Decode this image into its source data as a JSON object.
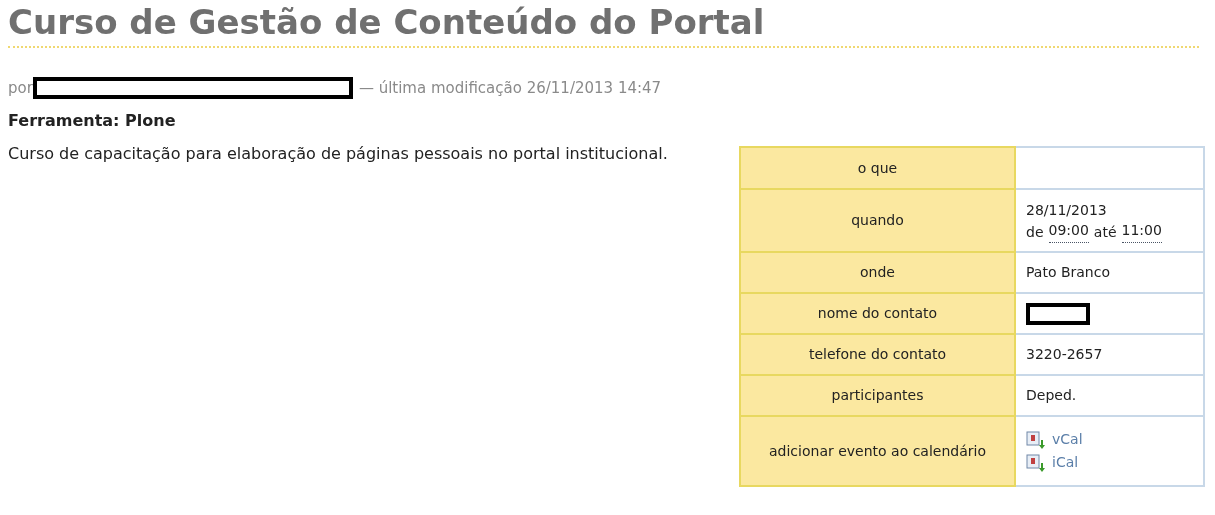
{
  "title": "Curso de Gestão de Conteúdo do Portal",
  "byline": {
    "prefix": "por",
    "suffix": "— última modificação 26/11/2013 14:47"
  },
  "subtitle": "Ferramenta: Plone",
  "description": "Curso de capacitação para elaboração de páginas pessoais no portal institucional.",
  "event_table": [
    {
      "label": "o que",
      "kind": "empty"
    },
    {
      "label": "quando",
      "kind": "when",
      "date": "28/11/2013",
      "from_word": "de",
      "start": "09:00",
      "to_word": "até",
      "end": "11:00"
    },
    {
      "label": "onde",
      "kind": "text",
      "value": "Pato Branco"
    },
    {
      "label": "nome do contato",
      "kind": "redacted"
    },
    {
      "label": "telefone do contato",
      "kind": "text",
      "value": "3220-2657"
    },
    {
      "label": "participantes",
      "kind": "text",
      "value": "Deped."
    },
    {
      "label": "adicionar evento ao calendário",
      "kind": "links",
      "links": [
        "vCal",
        "iCal"
      ]
    }
  ]
}
